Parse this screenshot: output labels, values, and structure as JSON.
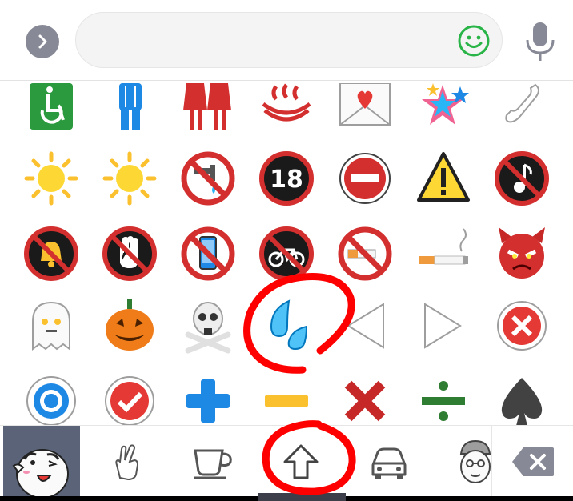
{
  "input": {
    "placeholder": "",
    "value": ""
  },
  "icons": {
    "expand": "chevron-right-icon",
    "emoji": "smiley-icon",
    "mic": "microphone-icon",
    "delete": "backspace-icon"
  },
  "emoji_rows": [
    [
      "wheelchair",
      "mens-room",
      "womens-room",
      "hot-springs",
      "love-letter",
      "shooting-star",
      "telephone-receiver"
    ],
    [
      "sun",
      "sun",
      "no-drinking-water",
      "no-under-eighteen",
      "no-entry",
      "warning",
      "no-music"
    ],
    [
      "no-bell",
      "no-touching",
      "no-mobile-phones",
      "no-bicycles",
      "no-smoking",
      "cigarette",
      "devil-face"
    ],
    [
      "ghost",
      "jack-o-lantern",
      "skull-and-crossbones",
      "sweat-droplets",
      "reverse-triangle",
      "play-triangle",
      "cross-mark-circle"
    ],
    [
      "radio-button",
      "check-mark-circle",
      "plus",
      "minus",
      "cross-mark",
      "division",
      "black-spade"
    ]
  ],
  "categories": [
    {
      "name": "sticker-character",
      "selected": true
    },
    {
      "name": "hand-gesture",
      "selected": false
    },
    {
      "name": "coffee-cup",
      "selected": false
    },
    {
      "name": "up-arrow",
      "selected": false
    },
    {
      "name": "car",
      "selected": false
    },
    {
      "name": "person-face",
      "selected": false
    }
  ],
  "colors": {
    "accent_green": "#28b446",
    "selected_category": "#5b6378",
    "annotation_red": "#ff0000",
    "icon_gray": "#878a96"
  }
}
